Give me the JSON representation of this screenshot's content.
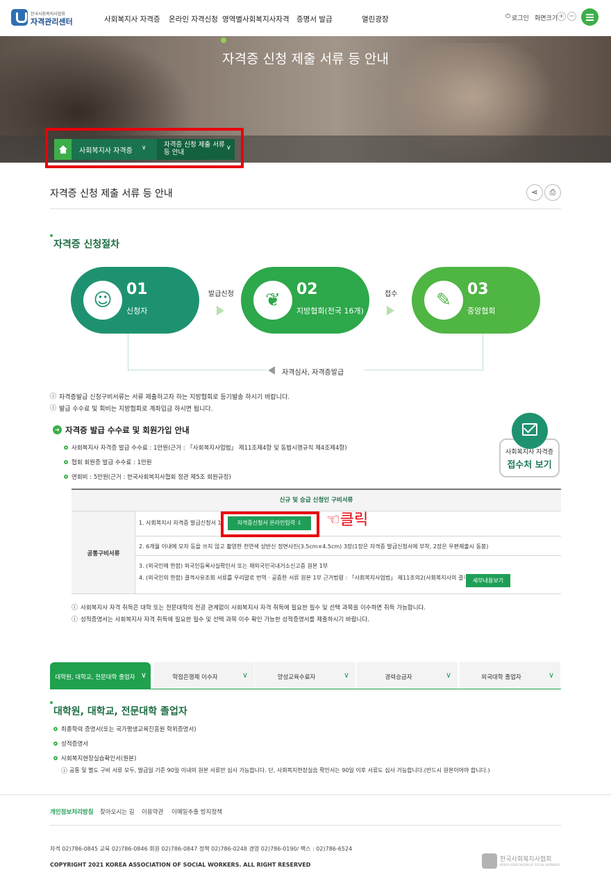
{
  "header": {
    "logo_sub": "한국사회복지사협회",
    "logo_title": "자격관리센터",
    "nav": [
      "사회복지사 자격증",
      "온라인 자격신청",
      "영역별사회복지사자격",
      "증명서 발급",
      "열린광장"
    ],
    "login": "로그인",
    "screen_size": "화면크기",
    "zoom_in": "+",
    "zoom_out": "−"
  },
  "hero": {
    "title": "자격증 신청 제출 서류 등 안내"
  },
  "breadcrumb": {
    "level1": "사회복지사 자격증",
    "level2": "자격증 신청 제출 서류 등 안내"
  },
  "page": {
    "title": "자격증 신청 제출 서류 등 안내"
  },
  "procedure": {
    "title": "자격증 신청절차",
    "steps": [
      {
        "no": "01",
        "label": "신청자",
        "icon": "applicant-icon"
      },
      {
        "no": "02",
        "label": "지방협회(전국 16개)",
        "icon": "plant-hand-icon"
      },
      {
        "no": "03",
        "label": "중앙협회",
        "icon": "certificate-icon"
      }
    ],
    "arrow1": "발급신청",
    "arrow2": "접수",
    "review": "자격심사, 자격증발급",
    "notes": [
      "자격증발급 신청구비서류는 서류 제출하고자 하는 지방협회로 등기발송 하시기 바랍니다.",
      "발급 수수료 및 회비는 지방협회로 계좌입금 하시면 됩니다."
    ]
  },
  "fee": {
    "title": "자격증 발급 수수료 및 회원가입 안내",
    "items": [
      "사회복지사 자격증 발급 수수료 : 1만원(근거 : 「사회복지사업법」 제11조제4항 및 동법시행규칙 제4조제4항)",
      "협회 회원증 발급 수수료 : 1만원",
      "연회비 : 5만원(근거 : 한국사회복지사협회 정관 제5조 회원규정)"
    ],
    "office_line1": "사회복지사 자격증",
    "office_line2": "접수처 보기"
  },
  "table": {
    "header": "신규 및 승급 신청인 구비서류",
    "category": "공통구비서류",
    "row1": "1. 사회복지사 자격증 발급신청서 1부",
    "online_button": "자격증신청서 온라인입력",
    "annotation": "☜클릭",
    "row2": "2. 6개월 이내에 모자 등을 쓰지 않고 촬영한 천연색 상반신 정면사진(3.5cm×4.5cm) 3장(1장은 자격증 발급신청서에 부착, 2장은 우편제출시 동봉)",
    "row3": "3. (외국인에 한함) 외국인등록사실확인서 또는 재외국민국내거소신고증 원본 1부",
    "row4": "4. (외국인의 한함) 결격사유조회 서류를 우리말로 번역 · 공증한 서류 원본 1부   근거법령 : 「사회복지사업법」 제11조의2(사회복지사의 결격사유) →",
    "detail_button": "세부내용보기"
  },
  "table_notes": [
    "사회복지사 자격 취득은 대학 또는 전문대학의 전공 관계없이 사회복지사 자격 취득에 필요한 필수 및 선택 과목을 이수하면 취득 가능합니다.",
    "성적증명서는 사회복지사 자격 취득에 필요한 필수 및 선택 과목 이수 확인 가능한 성적증명서를 제출하시기 바랍니다."
  ],
  "tabs": [
    "대학원, 대학교, 전문대학 졸업자",
    "학점은행제 이수자",
    "양성교육수료자",
    "경력승급자",
    "외국대학 졸업자"
  ],
  "graduate": {
    "title": "대학원, 대학교, 전문대학 졸업자",
    "items": [
      "최종학력 증명서(또는 국가평생교육진흥원 학위증명서)",
      "성적증명서",
      "사회복지현장실습확인서(원본)"
    ],
    "note": "공통 및 별도 구비 서류 모두, 발급일 기준 90일 이내의 원본 서류만 심사 가능합니다. 단, 사회복지현장실습 확인서는 90일 이후 서류도 심사 가능합니다.(반드시 원본이어야 합니다.)"
  },
  "footer": {
    "links": [
      "개인정보처리방침",
      "찾아오시는 길",
      "이용약관",
      "이메일추출 방지정책"
    ],
    "contact": "자격 02)786-0845 교육 02)786-0846 회원 02)786-0847 정책 02)786-0248 경영 02)786-0190/    팩스 : 02)786-6524",
    "copyright": "COPYRIGHT 2021 KOREA ASSOCIATION OF SOCIAL WORKERS. ALL RIGHT RESERVED",
    "logo_kr": "한국사회복지사협회",
    "logo_en": "KOREA ASSOCIATION OF SOCIAL WORKERS"
  },
  "colors": {
    "green": "#3daf4a",
    "teal": "#1e9270",
    "dark_green": "#19734e",
    "red_box": "#e8000b"
  }
}
